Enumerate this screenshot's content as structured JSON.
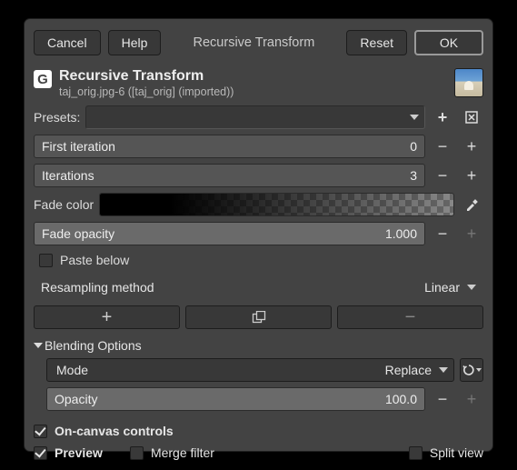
{
  "buttons": {
    "cancel": "Cancel",
    "help": "Help",
    "title": "Recursive Transform",
    "reset": "Reset",
    "ok": "OK"
  },
  "header": {
    "title": "Recursive Transform",
    "subtitle": "taj_orig.jpg-6 ([taj_orig] (imported))",
    "gegl_glyph": "G"
  },
  "presets": {
    "label": "Presets:"
  },
  "first_iteration": {
    "label": "First iteration",
    "value": "0"
  },
  "iterations": {
    "label": "Iterations",
    "value": "3"
  },
  "fade_color": {
    "label": "Fade color"
  },
  "fade_opacity": {
    "label": "Fade opacity",
    "value": "1.000"
  },
  "paste_below": {
    "label": "Paste below",
    "checked": false
  },
  "resampling": {
    "label": "Resampling method",
    "value": "Linear"
  },
  "blending": {
    "header": "Blending Options",
    "mode": {
      "label": "Mode",
      "value": "Replace"
    },
    "opacity": {
      "label": "Opacity",
      "value": "100.0"
    }
  },
  "on_canvas": {
    "label": "On-canvas controls",
    "checked": true
  },
  "preview": {
    "label": "Preview",
    "checked": true
  },
  "merge_filter": {
    "label": "Merge filter",
    "checked": false
  },
  "split_view": {
    "label": "Split view",
    "checked": false
  },
  "icons": {
    "plus": "+",
    "minus": "−",
    "add_preset": "add-preset",
    "manage_preset": "manage-preset",
    "color_reset": "color-reset",
    "dup": "duplicate-transform",
    "mode_reset": "reset-mode-icon"
  }
}
